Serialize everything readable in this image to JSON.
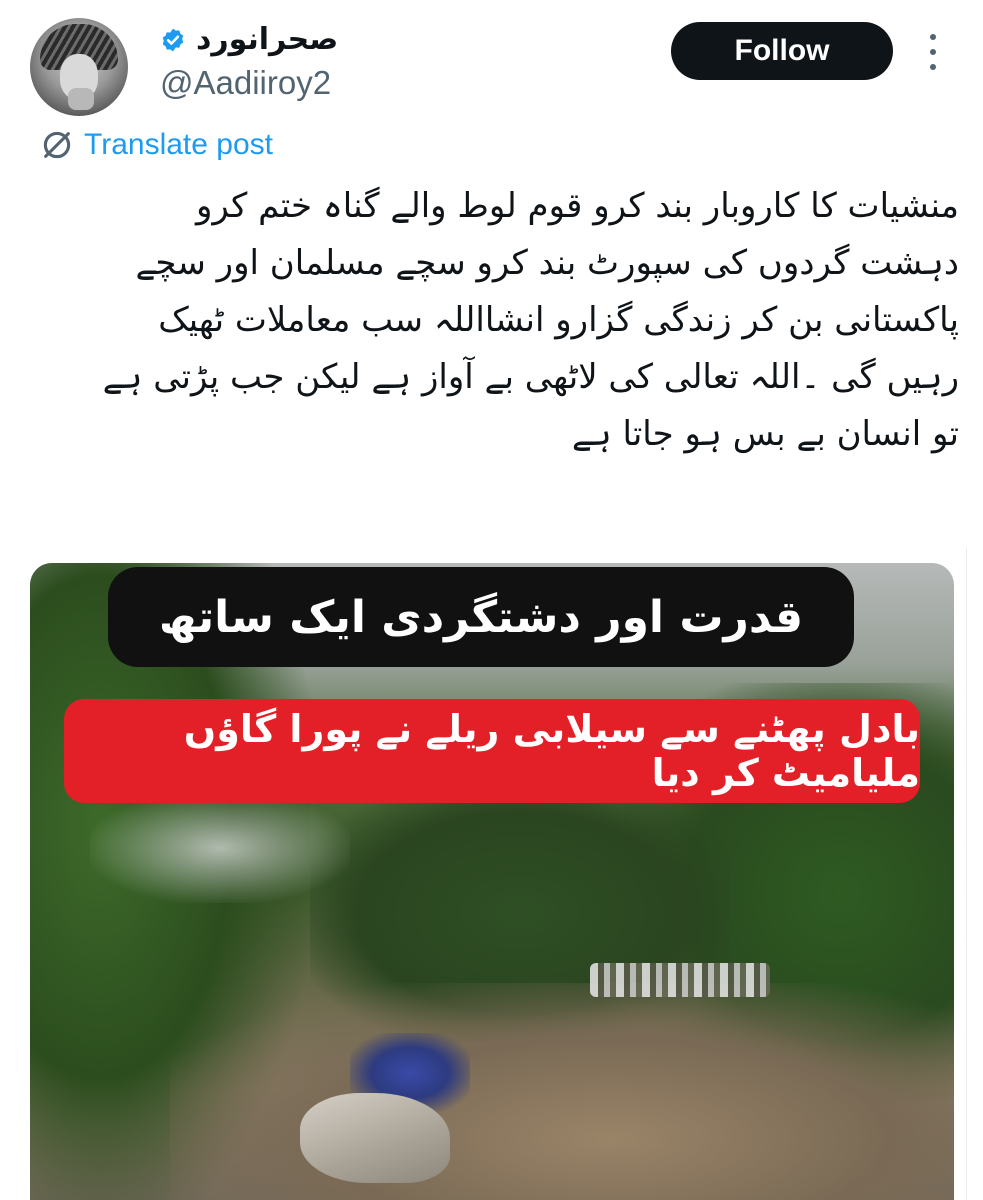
{
  "author": {
    "display_name": "صحرانورد",
    "handle": "@Aadiiroy2",
    "verified": true,
    "avatar_icon": "avatar-photo"
  },
  "actions": {
    "follow_label": "Follow",
    "more_icon": "more-options-icon"
  },
  "translate": {
    "label": "Translate post",
    "icon": "translate-icon",
    "color": "#1d9bf0"
  },
  "post": {
    "text_lines": [
      "منشیات کا کاروبار بند کرو قوم لوط والے گناہ ختم کرو",
      "دہشت گردوں کی سپورٹ بند کرو سچے مسلمان اور سچے",
      "پاکستانی بن کر زندگی گزارو انشااللہ سب معاملات ٹھیک",
      "رہیں گی ۔اللہ تعالی کی لاٹھی بے آواز ہے لیکن جب پڑتی ہے",
      "تو انسان بے بس ہو جاتا ہے"
    ]
  },
  "media": {
    "caption_top": "قدرت اور دشتگردی ایک ساتھ",
    "caption_bottom": "بادل پھٹنے سے سیلابی ریلے نے پورا گاؤں ملیامیٹ کر دیا",
    "caption_top_bg": "#111111",
    "caption_bottom_bg": "#e32027"
  },
  "colors": {
    "text_primary": "#0f1419",
    "text_secondary": "#536471",
    "follow_bg": "#0f1419",
    "verified": "#1d9bf0"
  }
}
